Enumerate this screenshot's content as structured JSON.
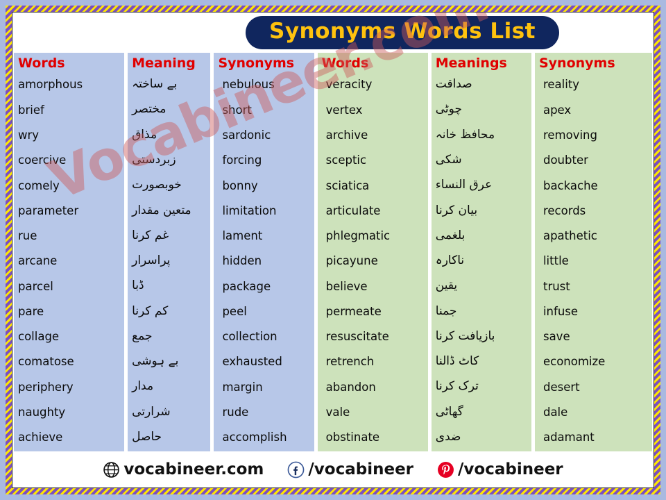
{
  "title": "Synonyms Words List",
  "theme": {
    "title_bg": "#10265e",
    "title_fg": "#ffc20e",
    "blue_col": "#b7c7e8",
    "green_col": "#cde2bb",
    "header_fg": "#e00000",
    "frame_stripe_a": "#ffe800",
    "frame_stripe_b": "#7b4fc0",
    "page_bg": "#a9b9e0",
    "watermark_color": "#cd5c5c"
  },
  "watermark": "Vocabineer.com",
  "headers": {
    "words_1": "Words",
    "meaning_1": "Meaning",
    "synonyms_1": "Synonyms",
    "words_2": "Words",
    "meanings_2": "Meanings",
    "synonyms_2": "Synonyms"
  },
  "left_table": {
    "words": [
      "amorphous",
      "brief",
      "wry",
      "coercive",
      "comely",
      "parameter",
      "rue",
      "arcane",
      "parcel",
      "pare",
      "collage",
      "comatose",
      "periphery",
      "naughty",
      "achieve"
    ],
    "meaning": [
      "بے ساختہ",
      "مختصر",
      "مذاق",
      "زبردستی",
      "خوبصورت",
      "متعین مقدار",
      "غم کرنا",
      "پراسرار",
      "ڈبا",
      "کم کرنا",
      "جمع",
      "بے ہوشی",
      "مدار",
      "شرارتی",
      "حاصل"
    ],
    "synonyms": [
      "nebulous",
      "short",
      "sardonic",
      "forcing",
      "bonny",
      "limitation",
      "lament",
      "hidden",
      "package",
      "peel",
      "collection",
      "exhausted",
      "margin",
      "rude",
      "accomplish"
    ]
  },
  "right_table": {
    "words": [
      "veracity",
      "vertex",
      "archive",
      "sceptic",
      "sciatica",
      "articulate",
      "phlegmatic",
      "picayune",
      "believe",
      "permeate",
      "resuscitate",
      "retrench",
      "abandon",
      "vale",
      "obstinate"
    ],
    "meanings": [
      "صداقت",
      "چوٹی",
      "محافظ خانہ",
      "شکی",
      "عرق النساء",
      "بیان کرنا",
      "بلغمی",
      "ناکارہ",
      "یقین",
      "جمنا",
      "بازیافت کرنا",
      "کاٹ ڈالنا",
      "ترک کرنا",
      "گھاٹی",
      "ضدی"
    ],
    "synonyms": [
      "reality",
      "apex",
      "removing",
      "doubter",
      "backache",
      "records",
      "apathetic",
      "little",
      "trust",
      "infuse",
      "save",
      "economize",
      "desert",
      "dale",
      "adamant"
    ]
  },
  "footer": {
    "website": {
      "icon": "globe-icon",
      "label": "vocabineer.com"
    },
    "facebook": {
      "icon": "facebook-icon",
      "label": "/vocabineer"
    },
    "pinterest": {
      "icon": "pinterest-icon",
      "label": "/vocabineer"
    }
  }
}
